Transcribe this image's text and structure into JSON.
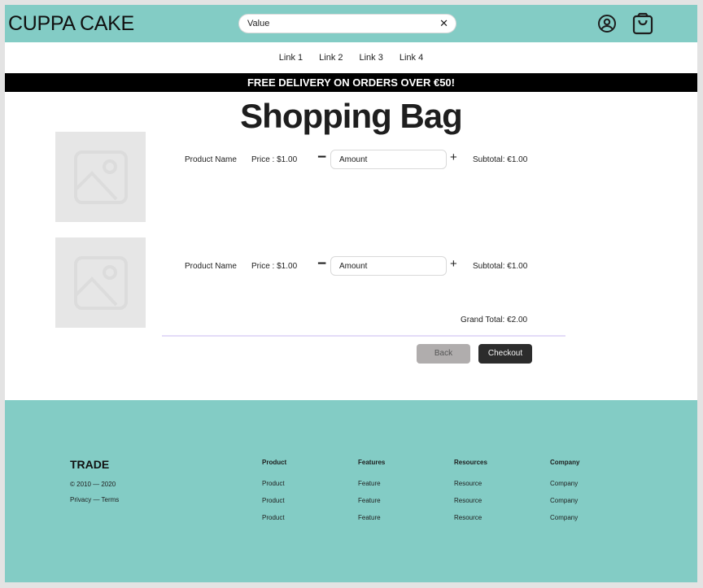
{
  "header": {
    "brand": "CUPPA CAKE",
    "search": {
      "value": "Value",
      "clear_glyph": "✕"
    },
    "icons": [
      "user-icon",
      "shopping-bag-icon"
    ]
  },
  "nav": {
    "links": [
      "Link 1",
      "Link 2",
      "Link 3",
      "Link 4"
    ]
  },
  "banner": "FREE DELIVERY ON ORDERS OVER €50!",
  "page": {
    "title": "Shopping Bag"
  },
  "cart": {
    "items": [
      {
        "name": "Product Name",
        "price": "Price : $1.00",
        "amount_placeholder": "Amount",
        "subtotal": "Subtotal: €1.00",
        "minus": "−",
        "plus": "+"
      },
      {
        "name": "Product Name",
        "price": "Price : $1.00",
        "amount_placeholder": "Amount",
        "subtotal": "Subtotal: €1.00",
        "minus": "−",
        "plus": "+"
      }
    ],
    "grand_total": "Grand Total: €2.00",
    "back_label": "Back",
    "checkout_label": "Checkout"
  },
  "footer": {
    "brand": "TRADE",
    "copyright": "© 2010 — 2020",
    "legal": "Privacy — Terms",
    "columns": [
      {
        "heading": "Product",
        "links": [
          "Product",
          "Product",
          "Product"
        ]
      },
      {
        "heading": "Features",
        "links": [
          "Feature",
          "Feature",
          "Feature"
        ]
      },
      {
        "heading": "Resources",
        "links": [
          "Resource",
          "Resource",
          "Resource"
        ]
      },
      {
        "heading": "Company",
        "links": [
          "Company",
          "Company",
          "Company"
        ]
      }
    ]
  },
  "colors": {
    "teal": "#83ccc5",
    "banner": "#000000",
    "checkout": "#2c2c2c",
    "back": "#b0adad",
    "placeholder_image": "#e6e6e6"
  }
}
